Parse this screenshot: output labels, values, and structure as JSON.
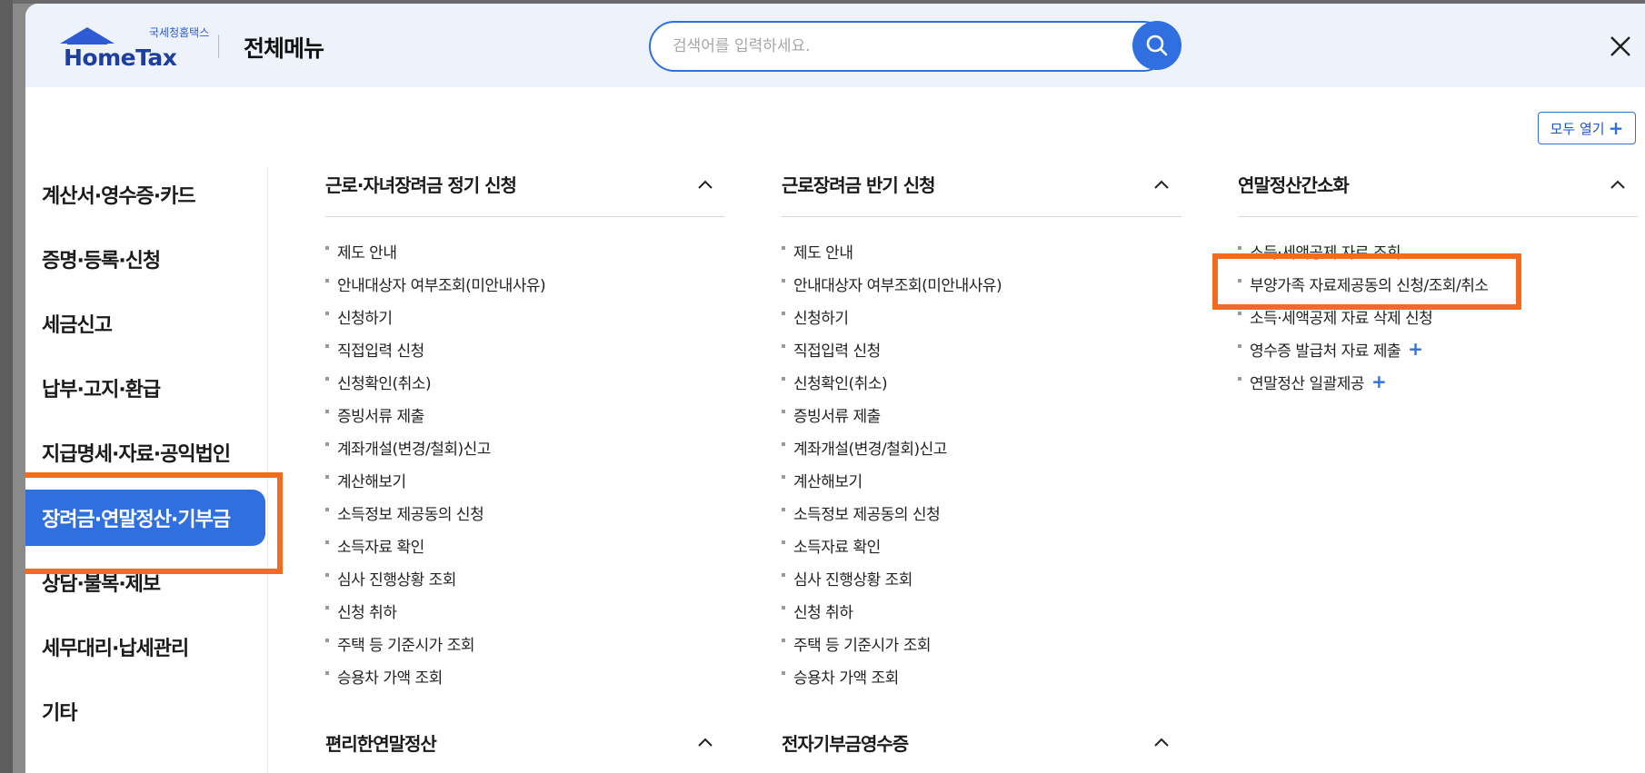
{
  "logo": {
    "small_text": "국세청홈택스",
    "brand": "HomeTax"
  },
  "header": {
    "title": "전체메뉴"
  },
  "search": {
    "placeholder": "검색어를 입력하세요."
  },
  "expand_all": {
    "label": "모두 열기",
    "plus": "+"
  },
  "sidebar": {
    "items": [
      {
        "label": "계산서·영수증·카드",
        "active": false
      },
      {
        "label": "증명·등록·신청",
        "active": false
      },
      {
        "label": "세금신고",
        "active": false
      },
      {
        "label": "납부·고지·환급",
        "active": false
      },
      {
        "label": "지급명세·자료·공익법인",
        "active": false
      },
      {
        "label": "장려금·연말정산·기부금",
        "active": true
      },
      {
        "label": "상담·불복·제보",
        "active": false
      },
      {
        "label": "세무대리·납세관리",
        "active": false
      },
      {
        "label": "기타",
        "active": false
      }
    ]
  },
  "columns": [
    {
      "title": "근로·자녀장려금 정기 신청",
      "items": [
        "제도 안내",
        "안내대상자 여부조회(미안내사유)",
        "신청하기",
        "직접입력 신청",
        "신청확인(취소)",
        "증빙서류 제출",
        "계좌개설(변경/철회)신고",
        "계산해보기",
        "소득정보 제공동의 신청",
        "소득자료 확인",
        "심사 진행상황 조회",
        "신청 취하",
        "주택 등 기준시가 조회",
        "승용차 가액 조회"
      ]
    },
    {
      "title": "근로장려금 반기 신청",
      "items": [
        "제도 안내",
        "안내대상자 여부조회(미안내사유)",
        "신청하기",
        "직접입력 신청",
        "신청확인(취소)",
        "증빙서류 제출",
        "계좌개설(변경/철회)신고",
        "계산해보기",
        "소득정보 제공동의 신청",
        "소득자료 확인",
        "심사 진행상황 조회",
        "신청 취하",
        "주택 등 기준시가 조회",
        "승용차 가액 조회"
      ]
    },
    {
      "title": "연말정산간소화",
      "items": [
        "소득·세액공제 자료 조회",
        "부양가족 자료제공동의 신청/조회/취소",
        "소득·세액공제 자료 삭제 신청",
        "영수증 발급처 자료 제출",
        "연말정산 일괄제공"
      ],
      "plus_items": [
        false,
        false,
        false,
        true,
        true
      ]
    }
  ],
  "bottom_sections": [
    "편리한연말정산",
    "전자기부금영수증"
  ],
  "plus_glyph": "+",
  "colors": {
    "accent": "#2f6fe0",
    "highlight": "#f36b20",
    "header_bg": "#eef3fb"
  }
}
